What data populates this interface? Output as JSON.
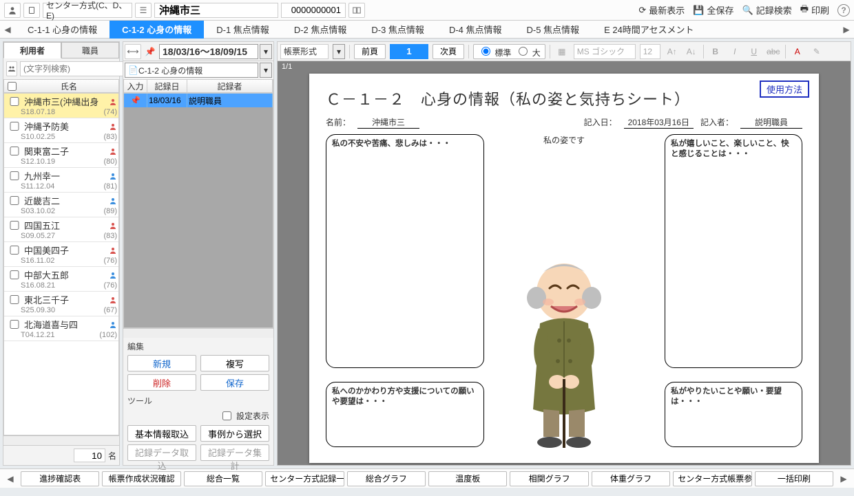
{
  "header": {
    "method": "センター方式(C、D、E)",
    "name": "沖縄市三",
    "number": "0000000001",
    "actions": {
      "refresh": "最新表示",
      "saveAll": "全保存",
      "search": "記録検索",
      "print": "印刷"
    }
  },
  "tabs": [
    "C-1-1 心身の情報",
    "C-1-2 心身の情報",
    "D-1 焦点情報",
    "D-2 焦点情報",
    "D-3 焦点情報",
    "D-4 焦点情報",
    "D-5 焦点情報",
    "E 24時間アセスメント"
  ],
  "activeTab": 1,
  "left": {
    "subtabs": [
      "利用者",
      "職員"
    ],
    "searchPlaceholder": "(文字列検索)",
    "colName": "氏名",
    "users": [
      {
        "name": "沖縄市三(沖縄出身",
        "date": "S18.07.18",
        "count": "(74)",
        "color": "#d9534f",
        "sel": true
      },
      {
        "name": "沖縄予防美",
        "date": "S10.02.25",
        "count": "(83)",
        "color": "#d9534f"
      },
      {
        "name": "関東富二子",
        "date": "S12.10.19",
        "count": "(80)",
        "color": "#d9534f"
      },
      {
        "name": "九州幸一",
        "date": "S11.12.04",
        "count": "(81)",
        "color": "#3b8ede"
      },
      {
        "name": "近畿吉二",
        "date": "S03.10.02",
        "count": "(89)",
        "color": "#3b8ede"
      },
      {
        "name": "四国五江",
        "date": "S09.05.27",
        "count": "(83)",
        "color": "#d9534f"
      },
      {
        "name": "中国美四子",
        "date": "S16.11.02",
        "count": "(76)",
        "color": "#d9534f"
      },
      {
        "name": "中部大五郎",
        "date": "S16.08.21",
        "count": "(76)",
        "color": "#3b8ede"
      },
      {
        "name": "東北三千子",
        "date": "S25.09.30",
        "count": "(67)",
        "color": "#d9534f"
      },
      {
        "name": "北海道喜与四",
        "date": "T04.12.21",
        "count": "(102)",
        "color": "#3b8ede"
      }
    ],
    "total": "10",
    "totalUnit": "名"
  },
  "mid": {
    "dateRange": "18/03/16～18/09/15",
    "recordSel": "C-1-2 心身の情報",
    "rhead": {
      "input": "入力",
      "date": "記録日",
      "author": "記録者"
    },
    "rows": [
      {
        "date": "18/03/16",
        "author": "説明職員"
      }
    ],
    "editLabel": "編集",
    "btns": {
      "new": "新規",
      "copy": "複写",
      "del": "削除",
      "save": "保存"
    },
    "toolLabel": "ツール",
    "settingShow": "設定表示",
    "tbtns": {
      "basic": "基本情報取込",
      "cases": "事例から選択",
      "recIn": "記録データ取込",
      "recAgg": "記録データ集計"
    }
  },
  "right": {
    "format": "帳票形式",
    "prev": "前頁",
    "page": "1",
    "next": "次頁",
    "size": {
      "std": "標準",
      "lg": "大"
    },
    "font": "MS ゴシック",
    "fontSize": "12",
    "pageCount": "1/1",
    "howto": "使用方法",
    "title": "Ｃ－１－２　心身の情報（私の姿と気持ちシート）",
    "meta": {
      "nameLbl": "名前：",
      "name": "沖縄市三",
      "dateLbl": "記入日：",
      "date": "2018年03月16日",
      "authLbl": "記入者：",
      "auth": "説明職員"
    },
    "bubbles": {
      "tl": "私の不安や苦痛、悲しみは・・・",
      "tc": "私の姿です",
      "tr": "私が嬉しいこと、楽しいこと、快と感じることは・・・",
      "bl": "私へのかかわり方や支援についての願いや要望は・・・",
      "br": "私がやりたいことや願い・要望は・・・"
    }
  },
  "bottom": [
    "進捗確認表",
    "帳票作成状況確認",
    "総合一覧",
    "センター方式記録一",
    "総合グラフ",
    "温度板",
    "相関グラフ",
    "体重グラフ",
    "センター方式帳票参",
    "一括印刷"
  ]
}
